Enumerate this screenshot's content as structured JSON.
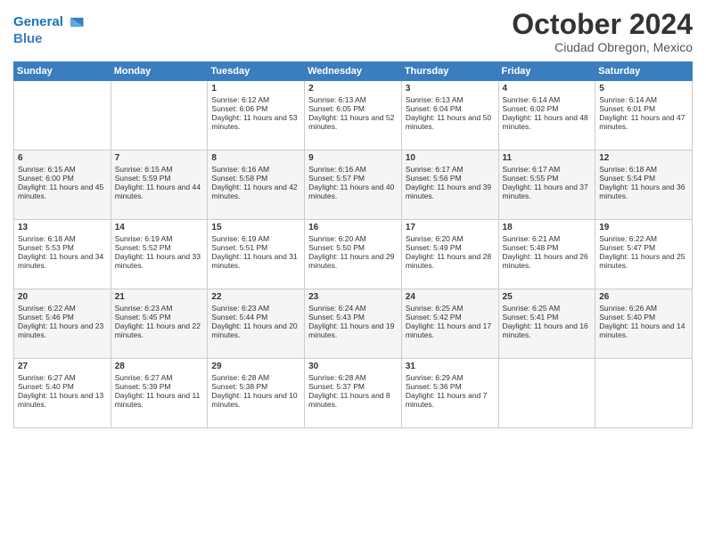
{
  "header": {
    "logo_line1": "General",
    "logo_line2": "Blue",
    "month": "October 2024",
    "location": "Ciudad Obregon, Mexico"
  },
  "weekdays": [
    "Sunday",
    "Monday",
    "Tuesday",
    "Wednesday",
    "Thursday",
    "Friday",
    "Saturday"
  ],
  "weeks": [
    [
      {
        "day": "",
        "sunrise": "",
        "sunset": "",
        "daylight": ""
      },
      {
        "day": "",
        "sunrise": "",
        "sunset": "",
        "daylight": ""
      },
      {
        "day": "1",
        "sunrise": "Sunrise: 6:12 AM",
        "sunset": "Sunset: 6:06 PM",
        "daylight": "Daylight: 11 hours and 53 minutes."
      },
      {
        "day": "2",
        "sunrise": "Sunrise: 6:13 AM",
        "sunset": "Sunset: 6:05 PM",
        "daylight": "Daylight: 11 hours and 52 minutes."
      },
      {
        "day": "3",
        "sunrise": "Sunrise: 6:13 AM",
        "sunset": "Sunset: 6:04 PM",
        "daylight": "Daylight: 11 hours and 50 minutes."
      },
      {
        "day": "4",
        "sunrise": "Sunrise: 6:14 AM",
        "sunset": "Sunset: 6:02 PM",
        "daylight": "Daylight: 11 hours and 48 minutes."
      },
      {
        "day": "5",
        "sunrise": "Sunrise: 6:14 AM",
        "sunset": "Sunset: 6:01 PM",
        "daylight": "Daylight: 11 hours and 47 minutes."
      }
    ],
    [
      {
        "day": "6",
        "sunrise": "Sunrise: 6:15 AM",
        "sunset": "Sunset: 6:00 PM",
        "daylight": "Daylight: 11 hours and 45 minutes."
      },
      {
        "day": "7",
        "sunrise": "Sunrise: 6:15 AM",
        "sunset": "Sunset: 5:59 PM",
        "daylight": "Daylight: 11 hours and 44 minutes."
      },
      {
        "day": "8",
        "sunrise": "Sunrise: 6:16 AM",
        "sunset": "Sunset: 5:58 PM",
        "daylight": "Daylight: 11 hours and 42 minutes."
      },
      {
        "day": "9",
        "sunrise": "Sunrise: 6:16 AM",
        "sunset": "Sunset: 5:57 PM",
        "daylight": "Daylight: 11 hours and 40 minutes."
      },
      {
        "day": "10",
        "sunrise": "Sunrise: 6:17 AM",
        "sunset": "Sunset: 5:56 PM",
        "daylight": "Daylight: 11 hours and 39 minutes."
      },
      {
        "day": "11",
        "sunrise": "Sunrise: 6:17 AM",
        "sunset": "Sunset: 5:55 PM",
        "daylight": "Daylight: 11 hours and 37 minutes."
      },
      {
        "day": "12",
        "sunrise": "Sunrise: 6:18 AM",
        "sunset": "Sunset: 5:54 PM",
        "daylight": "Daylight: 11 hours and 36 minutes."
      }
    ],
    [
      {
        "day": "13",
        "sunrise": "Sunrise: 6:18 AM",
        "sunset": "Sunset: 5:53 PM",
        "daylight": "Daylight: 11 hours and 34 minutes."
      },
      {
        "day": "14",
        "sunrise": "Sunrise: 6:19 AM",
        "sunset": "Sunset: 5:52 PM",
        "daylight": "Daylight: 11 hours and 33 minutes."
      },
      {
        "day": "15",
        "sunrise": "Sunrise: 6:19 AM",
        "sunset": "Sunset: 5:51 PM",
        "daylight": "Daylight: 11 hours and 31 minutes."
      },
      {
        "day": "16",
        "sunrise": "Sunrise: 6:20 AM",
        "sunset": "Sunset: 5:50 PM",
        "daylight": "Daylight: 11 hours and 29 minutes."
      },
      {
        "day": "17",
        "sunrise": "Sunrise: 6:20 AM",
        "sunset": "Sunset: 5:49 PM",
        "daylight": "Daylight: 11 hours and 28 minutes."
      },
      {
        "day": "18",
        "sunrise": "Sunrise: 6:21 AM",
        "sunset": "Sunset: 5:48 PM",
        "daylight": "Daylight: 11 hours and 26 minutes."
      },
      {
        "day": "19",
        "sunrise": "Sunrise: 6:22 AM",
        "sunset": "Sunset: 5:47 PM",
        "daylight": "Daylight: 11 hours and 25 minutes."
      }
    ],
    [
      {
        "day": "20",
        "sunrise": "Sunrise: 6:22 AM",
        "sunset": "Sunset: 5:46 PM",
        "daylight": "Daylight: 11 hours and 23 minutes."
      },
      {
        "day": "21",
        "sunrise": "Sunrise: 6:23 AM",
        "sunset": "Sunset: 5:45 PM",
        "daylight": "Daylight: 11 hours and 22 minutes."
      },
      {
        "day": "22",
        "sunrise": "Sunrise: 6:23 AM",
        "sunset": "Sunset: 5:44 PM",
        "daylight": "Daylight: 11 hours and 20 minutes."
      },
      {
        "day": "23",
        "sunrise": "Sunrise: 6:24 AM",
        "sunset": "Sunset: 5:43 PM",
        "daylight": "Daylight: 11 hours and 19 minutes."
      },
      {
        "day": "24",
        "sunrise": "Sunrise: 6:25 AM",
        "sunset": "Sunset: 5:42 PM",
        "daylight": "Daylight: 11 hours and 17 minutes."
      },
      {
        "day": "25",
        "sunrise": "Sunrise: 6:25 AM",
        "sunset": "Sunset: 5:41 PM",
        "daylight": "Daylight: 11 hours and 16 minutes."
      },
      {
        "day": "26",
        "sunrise": "Sunrise: 6:26 AM",
        "sunset": "Sunset: 5:40 PM",
        "daylight": "Daylight: 11 hours and 14 minutes."
      }
    ],
    [
      {
        "day": "27",
        "sunrise": "Sunrise: 6:27 AM",
        "sunset": "Sunset: 5:40 PM",
        "daylight": "Daylight: 11 hours and 13 minutes."
      },
      {
        "day": "28",
        "sunrise": "Sunrise: 6:27 AM",
        "sunset": "Sunset: 5:39 PM",
        "daylight": "Daylight: 11 hours and 11 minutes."
      },
      {
        "day": "29",
        "sunrise": "Sunrise: 6:28 AM",
        "sunset": "Sunset: 5:38 PM",
        "daylight": "Daylight: 11 hours and 10 minutes."
      },
      {
        "day": "30",
        "sunrise": "Sunrise: 6:28 AM",
        "sunset": "Sunset: 5:37 PM",
        "daylight": "Daylight: 11 hours and 8 minutes."
      },
      {
        "day": "31",
        "sunrise": "Sunrise: 6:29 AM",
        "sunset": "Sunset: 5:36 PM",
        "daylight": "Daylight: 11 hours and 7 minutes."
      },
      {
        "day": "",
        "sunrise": "",
        "sunset": "",
        "daylight": ""
      },
      {
        "day": "",
        "sunrise": "",
        "sunset": "",
        "daylight": ""
      }
    ]
  ]
}
